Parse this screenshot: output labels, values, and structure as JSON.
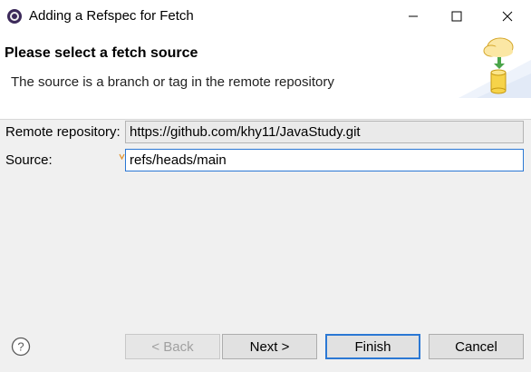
{
  "window": {
    "title": "Adding a Refspec for Fetch",
    "controls": [
      "minimize-icon",
      "maximize-icon",
      "close-icon"
    ]
  },
  "header": {
    "title": "Please select a fetch source",
    "description": "The source is a branch or tag in the remote repository",
    "image_icon": "cloud-download-database-icon"
  },
  "form": {
    "remote_label": "Remote repository:",
    "remote_value": "https://github.com/khy11/JavaStudy.git",
    "source_label": "Source:",
    "source_value": "refs/heads/main"
  },
  "buttons": {
    "back_label": "< Back",
    "next_label": "Next >",
    "finish_label": "Finish",
    "cancel_label": "Cancel",
    "help_icon": "help-icon"
  },
  "colors": {
    "focus_blue": "#2b78d4",
    "dialog_bg": "#f0f0f0"
  }
}
